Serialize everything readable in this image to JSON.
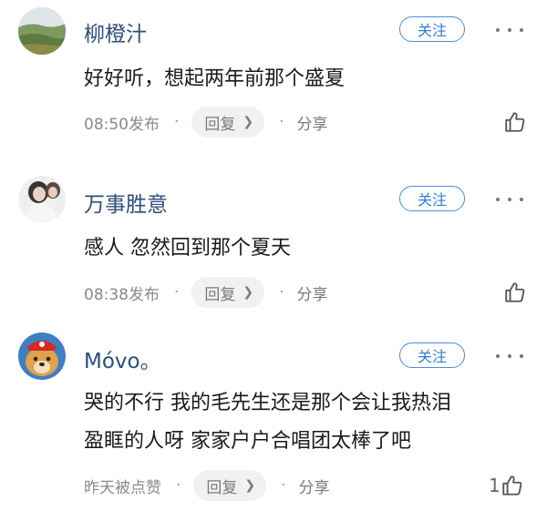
{
  "comments": [
    {
      "username": "柳橙汁",
      "follow_label": "关注",
      "text": "好好听，想起两年前那个盛夏",
      "time": "08:50发布",
      "reply_label": "回复",
      "share_label": "分享",
      "like_count": ""
    },
    {
      "username": "万事胜意",
      "follow_label": "关注",
      "text": "感人  忽然回到那个夏天",
      "time": "08:38发布",
      "reply_label": "回复",
      "share_label": "分享",
      "like_count": ""
    },
    {
      "username": "Móvo。",
      "follow_label": "关注",
      "text_lines": [
        "哭的不行 我的毛先生还是那个会让我热泪",
        "盈眶的人呀  家家户户合唱团太棒了吧"
      ],
      "time": "昨天被点赞",
      "reply_label": "回复",
      "share_label": "分享",
      "like_count": "1"
    }
  ],
  "icons": {
    "more": "more-dots-icon",
    "reply_chevron": "chevron-right-icon",
    "like": "thumbs-up-icon"
  },
  "colors": {
    "username": "#2d4f7c",
    "follow_accent": "#4a8fd8",
    "meta_gray": "#8a8a8a"
  }
}
